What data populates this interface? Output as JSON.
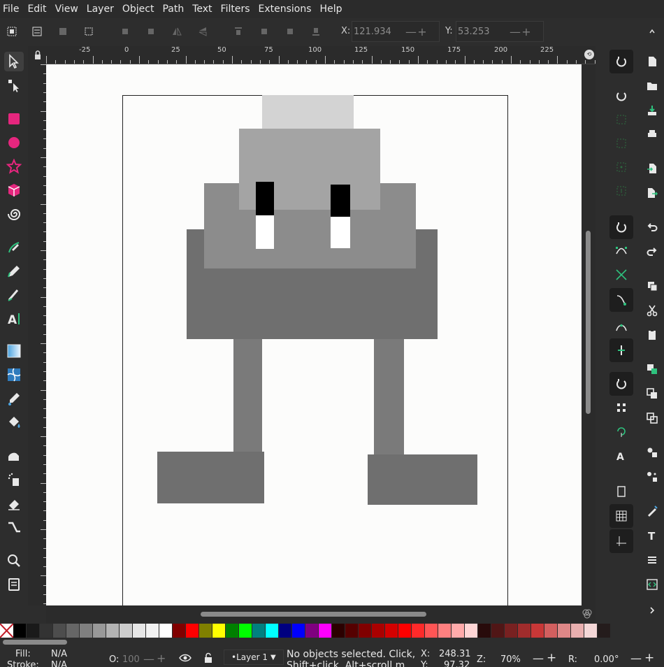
{
  "menubar": {
    "items": [
      "File",
      "Edit",
      "View",
      "Layer",
      "Object",
      "Path",
      "Text",
      "Filters",
      "Extensions",
      "Help"
    ]
  },
  "toolcontrols": {
    "x_label": "X:",
    "x_value": "121.934",
    "y_label": "Y:",
    "y_value": "53.253"
  },
  "ruler": {
    "h_labels": [
      "-25",
      "0",
      "25",
      "50",
      "75",
      "100",
      "125",
      "150",
      "175",
      "200",
      "225"
    ]
  },
  "colors": {
    "accent_pink": "#e6267e",
    "accent_green": "#2ec27e",
    "robot_light": "#d3d3d3",
    "robot_mid": "#a4a4a4",
    "robot_grey": "#8c8c8c",
    "robot_dark": "#6f6f6f",
    "robot_leg": "#7a7a7a"
  },
  "palette": {
    "swatches": [
      "#000000",
      "#1a1a1a",
      "#333333",
      "#4d4d4d",
      "#666666",
      "#808080",
      "#999999",
      "#b3b3b3",
      "#cccccc",
      "#e6e6e6",
      "#f2f2f2",
      "#ffffff",
      "#800000",
      "#ff0000",
      "#808000",
      "#ffff00",
      "#008000",
      "#00ff00",
      "#008080",
      "#00ffff",
      "#000080",
      "#0000ff",
      "#800080",
      "#ff00ff",
      "#2b0000",
      "#550000",
      "#800000",
      "#aa0000",
      "#d40000",
      "#ff0000",
      "#ff2a2a",
      "#ff5555",
      "#ff8080",
      "#ffaaaa",
      "#ffd5d5",
      "#280b0b",
      "#501616",
      "#782121",
      "#a02c2c",
      "#c83737",
      "#d35f5f",
      "#de8787",
      "#e9afaf",
      "#f4d7d7",
      "#241c1c"
    ]
  },
  "status": {
    "fill_label": "Fill:",
    "fill_value": "N/A",
    "stroke_label": "Stroke:",
    "stroke_value": "N/A",
    "opacity_label": "O:",
    "opacity_value": "100",
    "layer_name": "•Layer 1",
    "message_line1": "No objects selected. Click,",
    "message_line2": "Shift+click, Alt+scroll m",
    "cursor_x_label": "X:",
    "cursor_x": "248.31",
    "cursor_y_label": "Y:",
    "cursor_y": "97.32",
    "zoom_label": "Z:",
    "zoom_value": "70%",
    "rotation_label": "R:",
    "rotation_value": "0.00°"
  }
}
